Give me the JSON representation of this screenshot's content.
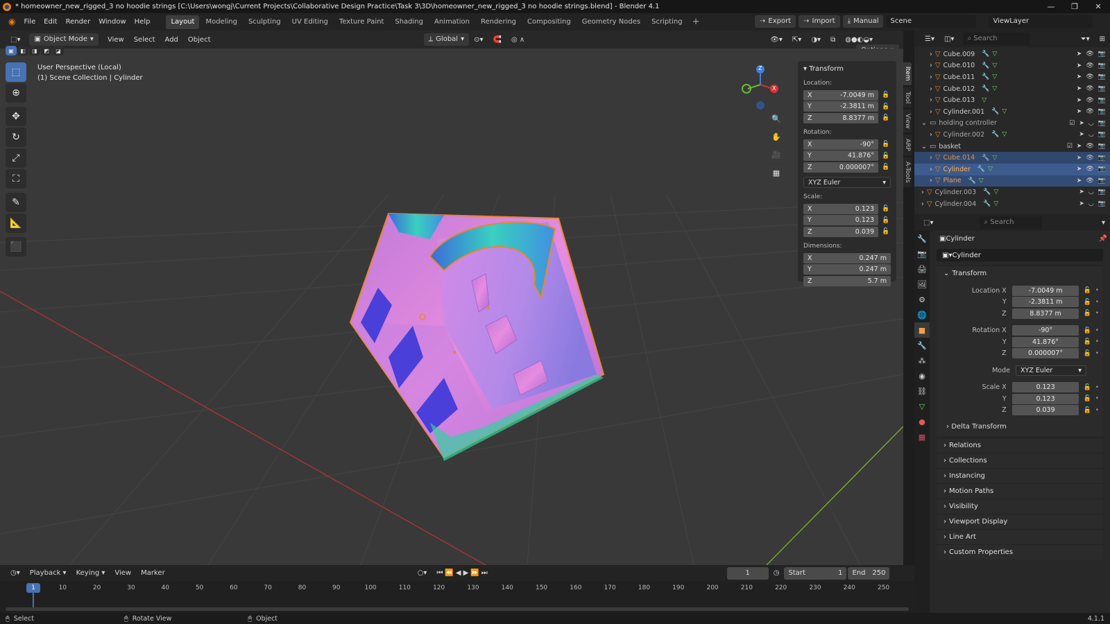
{
  "window": {
    "title": "* homeowner_new_rigged_3 no hoodie strings [C:\\Users\\wongj\\Current Projects\\Collaborative Design Practice\\Task 3\\3D\\homeowner_new_rigged_3 no hoodie strings.blend] - Blender 4.1"
  },
  "menus": [
    "File",
    "Edit",
    "Render",
    "Window",
    "Help"
  ],
  "workspaces": [
    "Layout",
    "Modeling",
    "Sculpting",
    "UV Editing",
    "Texture Paint",
    "Shading",
    "Animation",
    "Rendering",
    "Compositing",
    "Geometry Nodes",
    "Scripting"
  ],
  "topright": {
    "export": "Export",
    "import": "Import",
    "manual": "Manual",
    "scene": "Scene",
    "viewlayer": "ViewLayer"
  },
  "viewport_header": {
    "mode": "Object Mode",
    "menus": [
      "View",
      "Select",
      "Add",
      "Object"
    ],
    "orientation": "Global",
    "options": "Options"
  },
  "viewport_info": {
    "line1": "User Perspective (Local)",
    "line2": "(1) Scene Collection | Cylinder"
  },
  "npanel": {
    "title": "Transform",
    "location_label": "Location:",
    "location": [
      "-7.0049 m",
      "-2.3811 m",
      "8.8377 m"
    ],
    "rotation_label": "Rotation:",
    "rotation": [
      "-90°",
      "41.876°",
      "0.000007°"
    ],
    "rotation_mode": "XYZ Euler",
    "scale_label": "Scale:",
    "scale": [
      "0.123",
      "0.123",
      "0.039"
    ],
    "dimensions_label": "Dimensions:",
    "dimensions": [
      "0.247 m",
      "0.247 m",
      "5.7 m"
    ],
    "axes": [
      "X",
      "Y",
      "Z"
    ],
    "tabs": [
      "Item",
      "Tool",
      "View",
      "ARP",
      "A-Tools"
    ]
  },
  "gizmo": {
    "z": "Z",
    "x": "X"
  },
  "outliner": {
    "search_placeholder": "Search",
    "rows": [
      {
        "name": "Cube.009",
        "type": "mesh"
      },
      {
        "name": "Cube.010",
        "type": "mesh"
      },
      {
        "name": "Cube.011",
        "type": "mesh"
      },
      {
        "name": "Cube.012",
        "type": "mesh"
      },
      {
        "name": "Cube.013",
        "type": "mesh"
      },
      {
        "name": "Cylinder.001",
        "type": "mesh"
      },
      {
        "name": "holding controller",
        "type": "collection"
      },
      {
        "name": "Cylinder.002",
        "type": "mesh"
      },
      {
        "name": "basket",
        "type": "collection"
      },
      {
        "name": "Cube.014",
        "type": "mesh"
      },
      {
        "name": "Cylinder",
        "type": "mesh"
      },
      {
        "name": "Plane",
        "type": "mesh"
      },
      {
        "name": "Cylinder.003",
        "type": "mesh"
      },
      {
        "name": "Cylinder.004",
        "type": "mesh"
      }
    ]
  },
  "properties": {
    "search_placeholder": "Search",
    "object_name": "Cylinder",
    "name_field": "Cylinder",
    "transform_title": "Transform",
    "location_x_label": "Location X",
    "y_label": "Y",
    "z_label": "Z",
    "rotation_x_label": "Rotation X",
    "mode_label": "Mode",
    "scale_x_label": "Scale X",
    "location": [
      "-7.0049 m",
      "-2.3811 m",
      "8.8377 m"
    ],
    "rotation": [
      "-90°",
      "41.876°",
      "0.000007°"
    ],
    "mode": "XYZ Euler",
    "scale": [
      "0.123",
      "0.123",
      "0.039"
    ],
    "delta": "Delta Transform",
    "sections": [
      "Relations",
      "Collections",
      "Instancing",
      "Motion Paths",
      "Visibility",
      "Viewport Display",
      "Line Art",
      "Custom Properties"
    ]
  },
  "timeline": {
    "menus": [
      "Playback",
      "Keying",
      "View",
      "Marker"
    ],
    "current_frame": "1",
    "start_label": "Start",
    "start": "1",
    "end_label": "End",
    "end": "250",
    "ticks": [
      "1",
      "10",
      "20",
      "30",
      "40",
      "50",
      "60",
      "70",
      "80",
      "90",
      "100",
      "110",
      "120",
      "130",
      "140",
      "150",
      "160",
      "170",
      "180",
      "190",
      "200",
      "210",
      "220",
      "230",
      "240",
      "250"
    ]
  },
  "statusbar": {
    "select": "Select",
    "rotate": "Rotate View",
    "object": "Object",
    "version": "4.1.1"
  },
  "colors": {
    "accent": "#4772b3",
    "selection": "#334c76",
    "mesh_icon": "#e2892f"
  }
}
